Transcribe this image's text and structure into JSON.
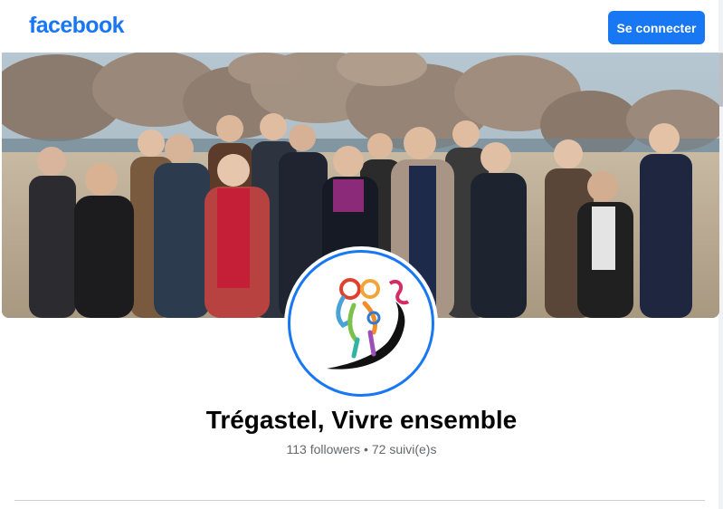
{
  "header": {
    "logo_text": "facebook",
    "login_label": "Se connecter"
  },
  "profile": {
    "name": "Trégastel, Vivre ensemble",
    "followers": "113 followers",
    "separator": "•",
    "following": "72 suivi(e)s"
  },
  "colors": {
    "brand": "#1877f2",
    "text_primary": "#050505",
    "text_secondary": "#65676b"
  },
  "icons": {
    "cover": "cover-photo",
    "avatar": "community-logo"
  }
}
